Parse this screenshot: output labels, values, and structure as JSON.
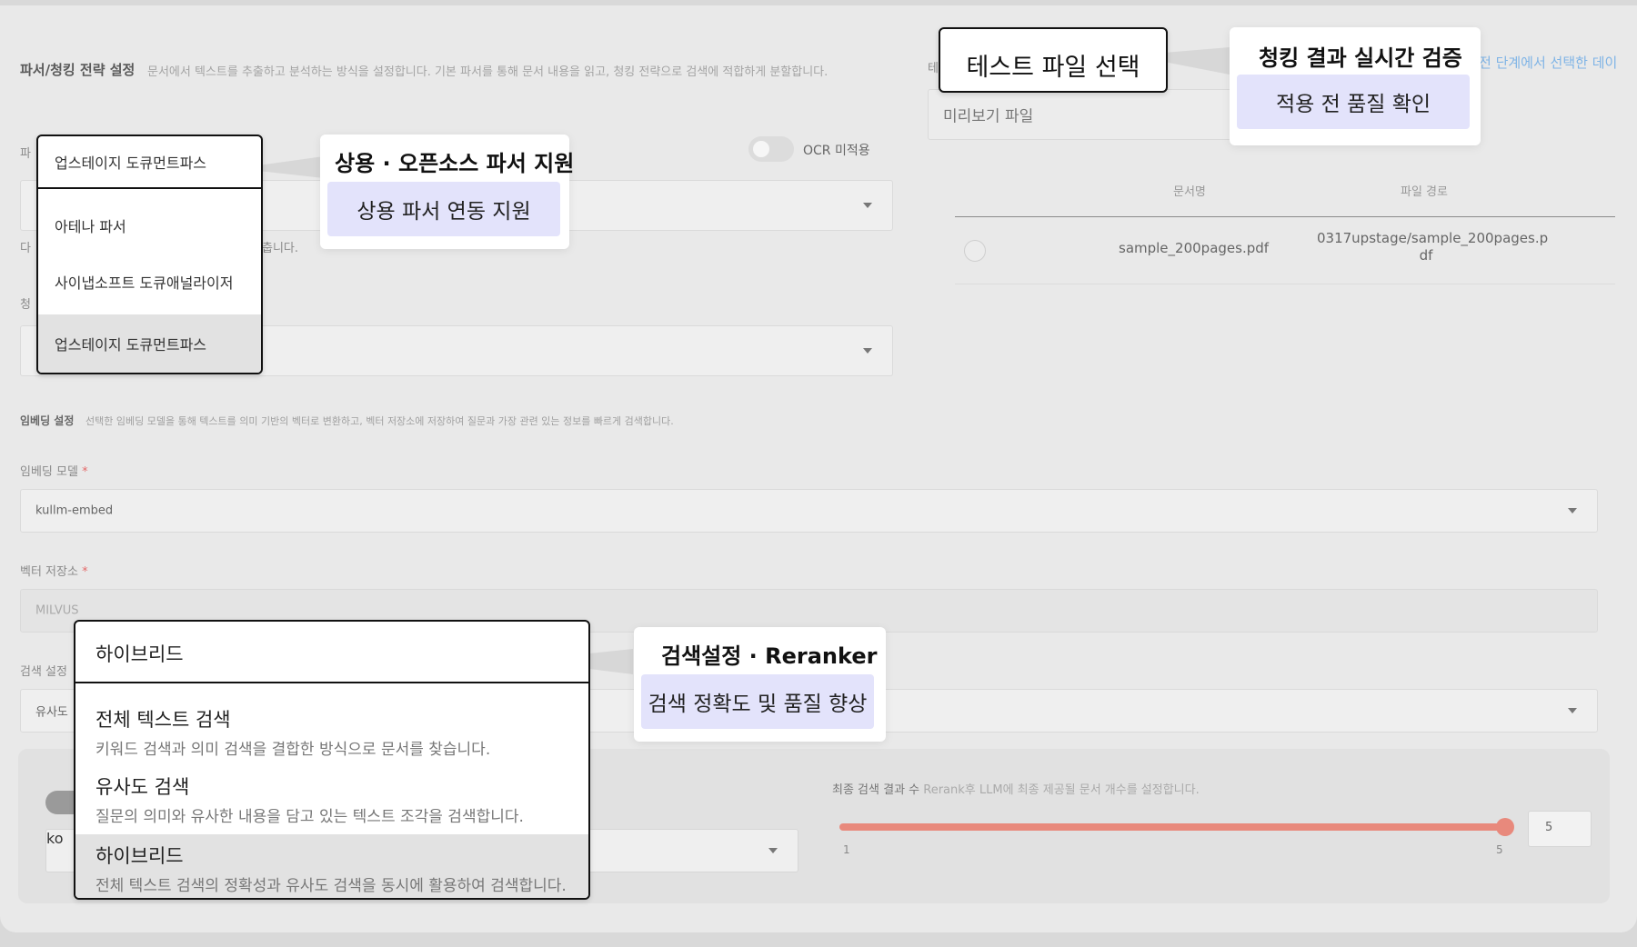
{
  "parser_section": {
    "title": "파서/청킹 전략 설정",
    "description": "문서에서 텍스트를 추출하고 분석하는 방식을 설정합니다. 기본 파서를 통해 문서 내용을 읽고, 청킹 전략으로 검색에 적합하게 분할합니다.",
    "parser_label_partial": "파",
    "chunking_label_partial": "청",
    "hint_prefix": "다",
    "hint_suffix": "춥니다.",
    "ocr_label": "OCR 미적용"
  },
  "parser_dropdown": {
    "selected": "업스테이지 도큐먼트파스",
    "options": [
      "아테나 파서",
      "사이냅소프트 도큐애널라이저",
      "업스테이지 도큐먼트파스"
    ]
  },
  "embedding_section": {
    "title": "임베딩 설정",
    "description": "선택한 임베딩 모델을 통해 텍스트를 의미 기반의 벡터로 변환하고, 벡터 저장소에 저장하여 질문과 가장 관련 있는 정보를 빠르게 검색합니다.",
    "model_label": "임베딩 모델",
    "model_value": "kullm-embed",
    "vector_label": "벡터 저장소",
    "vector_value": "MILVUS",
    "search_label": "검색 설정",
    "search_value_partial": "유사도",
    "rerank_value_partial": "ko",
    "required_mark": "*"
  },
  "search_dropdown": {
    "selected": "하이브리드",
    "options": [
      {
        "title": "전체 텍스트 검색",
        "desc": "키워드 검색과 의미 검색을 결합한 방식으로 문서를 찾습니다."
      },
      {
        "title": "유사도 검색",
        "desc": "질문의 의미와 유사한 내용을 담고 있는 텍스트 조각을 검색합니다."
      },
      {
        "title": "하이브리드",
        "desc": "전체 텍스트 검색의 정확성과 유사도 검색을 동시에 활용하여 검색합니다."
      }
    ]
  },
  "final_results": {
    "label": "최종 검색 결과 수",
    "desc": "Rerank후 LLM에 최종 제공될 문서 개수를 설정합니다.",
    "min": "1",
    "max": "5",
    "value": "5",
    "slider_fraction": 1.0
  },
  "test_file": {
    "label_partial": "테",
    "link_text": "전 단계에서 선택한 데이",
    "preview_placeholder": "미리보기 파일",
    "table_headers": [
      "문서명",
      "파일 경로"
    ],
    "rows": [
      {
        "name": "sample_200pages.pdf",
        "path_line1": "0317upstage/sample_200pages.p",
        "path_line2": "df"
      }
    ]
  },
  "callouts": {
    "test_file_title": "테스트 파일 선택",
    "chunk_tip_title": "청킹 결과 실시간 검증",
    "chunk_tip_chip": "적용 전 품질 확인",
    "parser_tip_title": "상용 · 오픈소스 파서 지원",
    "parser_tip_chip": "상용 파서 연동 지원",
    "search_tip_title": "검색설정 · Reranker",
    "search_tip_chip": "검색 정확도 및 품질 향상"
  },
  "colors": {
    "accent_slider": "#e8897c",
    "chip_bg": "#e3e3fb",
    "link": "#7fb4e6"
  }
}
